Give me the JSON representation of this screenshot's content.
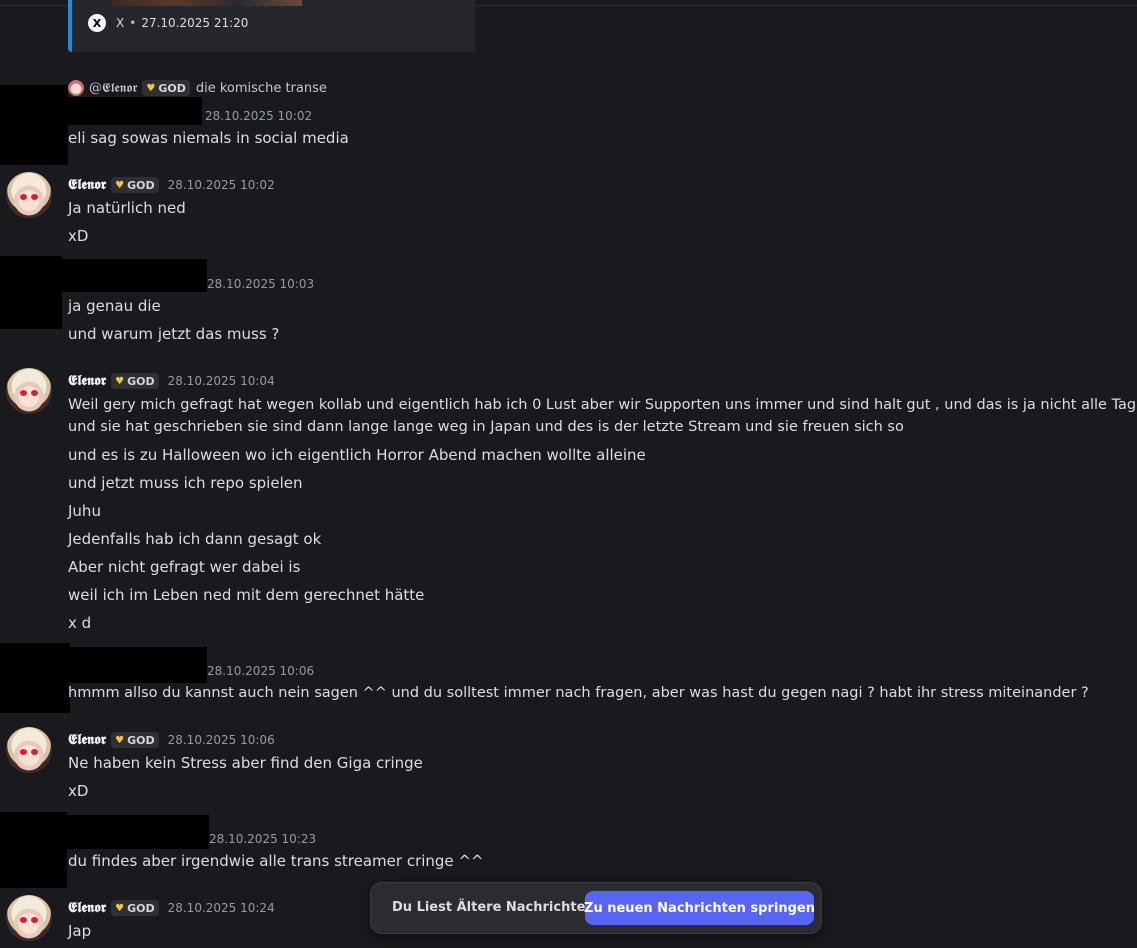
{
  "embed": {
    "source": "X",
    "separator": "•",
    "timestamp": "27.10.2025 21:20"
  },
  "messages": [
    {
      "author": "",
      "reply": {
        "mention": "@𝕰𝖑𝖊𝖓𝖔𝖗",
        "tag": "GOD",
        "text": "die komische transe"
      },
      "timestamp": "28.10.2025 10:02",
      "lines": [
        "eli sag sowas niemals in social media"
      ]
    },
    {
      "author": "𝕰𝖑𝖊𝖓𝖔𝖗",
      "tag": "GOD",
      "timestamp": "28.10.2025 10:02",
      "lines": [
        "Ja natürlich ned",
        "xD"
      ]
    },
    {
      "author": "",
      "timestamp": "28.10.2025 10:03",
      "lines": [
        "ja genau die",
        "und warum jetzt das muss ?"
      ]
    },
    {
      "author": "𝕰𝖑𝖊𝖓𝖔𝖗",
      "tag": "GOD",
      "timestamp": "28.10.2025 10:04",
      "lines": [
        "Weil gery mich gefragt hat wegen kollab und eigentlich hab ich 0 Lust aber wir Supporten uns immer und sind halt gut , und das is ja nicht alle Tage",
        "und sie hat geschrieben sie sind dann lange lange weg in Japan und des is der letzte Stream und sie freuen sich so",
        "und es is zu Halloween wo ich eigentlich Horror Abend machen wollte alleine",
        "und jetzt muss ich repo spielen",
        "Juhu",
        "Jedenfalls hab ich dann gesagt ok",
        "Aber nicht gefragt wer dabei is",
        "weil ich im Leben ned mit dem gerechnet hätte",
        "x d"
      ]
    },
    {
      "author": "",
      "timestamp": "28.10.2025 10:06",
      "lines": [
        "hmmm allso du kannst auch nein sagen ^^ und du solltest immer nach fragen, aber was hast du gegen nagi ? habt ihr stress miteinander ?"
      ]
    },
    {
      "author": "𝕰𝖑𝖊𝖓𝖔𝖗",
      "tag": "GOD",
      "timestamp": "28.10.2025 10:06",
      "lines": [
        "Ne haben kein Stress aber find den Giga cringe",
        "xD"
      ]
    },
    {
      "author": "",
      "timestamp": "28.10.2025 10:23",
      "lines": [
        "du findes aber irgendwie alle trans streamer cringe ^^"
      ]
    },
    {
      "author": "𝕰𝖑𝖊𝖓𝖔𝖗",
      "tag": "GOD",
      "timestamp": "28.10.2025 10:24",
      "lines": [
        "Jap"
      ]
    }
  ],
  "jump_bar": {
    "label": "Du Liest Ältere Nachrichten",
    "button": "Zu neuen Nachrichten springen"
  },
  "colors": {
    "background": "#1a1a1e",
    "accent": "#5865f2",
    "embed_border": "#1d8ce3",
    "heart": "#f0c93a"
  },
  "icons": {
    "embed_source": "x-logo-icon",
    "role_badge": "heart-icon"
  }
}
